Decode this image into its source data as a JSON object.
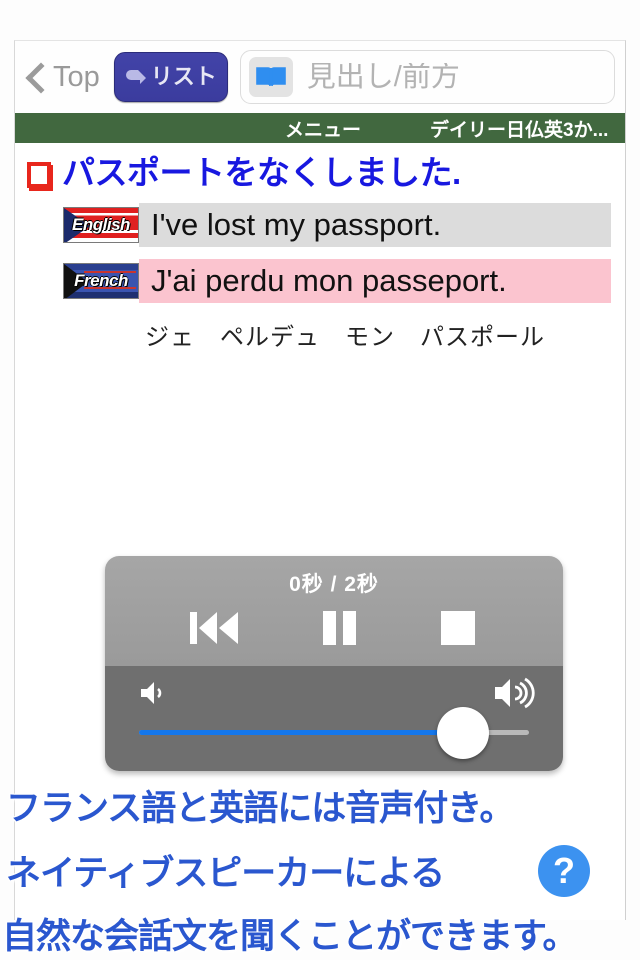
{
  "toolbar": {
    "back_label": "Top",
    "list_label": "リスト",
    "list_icon": "return-arrow-icon",
    "back_icon": "chevron-left-icon",
    "search": {
      "icon": "open-book-icon",
      "placeholder": "見出し/前方",
      "value": ""
    }
  },
  "menu_bar": {
    "menu_label": "メニュー",
    "dictionary_title": "デイリー日仏英3か...",
    "background": "#41683f"
  },
  "entry": {
    "bullet_icon": "red-square-icon",
    "headword": "パスポートをなくしました.",
    "headword_color": "#1818e0",
    "translations": [
      {
        "badge": "English",
        "badge_icon": "us-flag-icon",
        "text": "I've lost my passport.",
        "highlight": "#dcdcdc"
      },
      {
        "badge": "French",
        "badge_icon": "french-flag-icon",
        "text": "J'ai perdu mon passeport.",
        "highlight": "#fbc4cf"
      }
    ],
    "pronunciation": "ジェ　ペルデュ　モン　パスポール"
  },
  "player": {
    "time_display": "0秒 / 2秒",
    "current_time": "0秒",
    "total_time": "2秒",
    "controls": [
      {
        "name": "rewind-button",
        "icon": "skip-back-icon"
      },
      {
        "name": "pause-button",
        "icon": "pause-icon"
      },
      {
        "name": "stop-button",
        "icon": "stop-icon"
      }
    ],
    "volume": {
      "low_icon": "volume-low-icon",
      "high_icon": "volume-high-icon",
      "level_percent": 83,
      "fill_color": "#1477ec"
    }
  },
  "captions": {
    "line1": "フランス語と英語には音声付き。",
    "line2": "ネイティブスピーカーによる",
    "line3": "自然な会話文を聞くことができます。",
    "color": "#2a57cf"
  },
  "help": {
    "icon": "question-mark-icon",
    "label": "?",
    "color": "#3c92f0"
  }
}
